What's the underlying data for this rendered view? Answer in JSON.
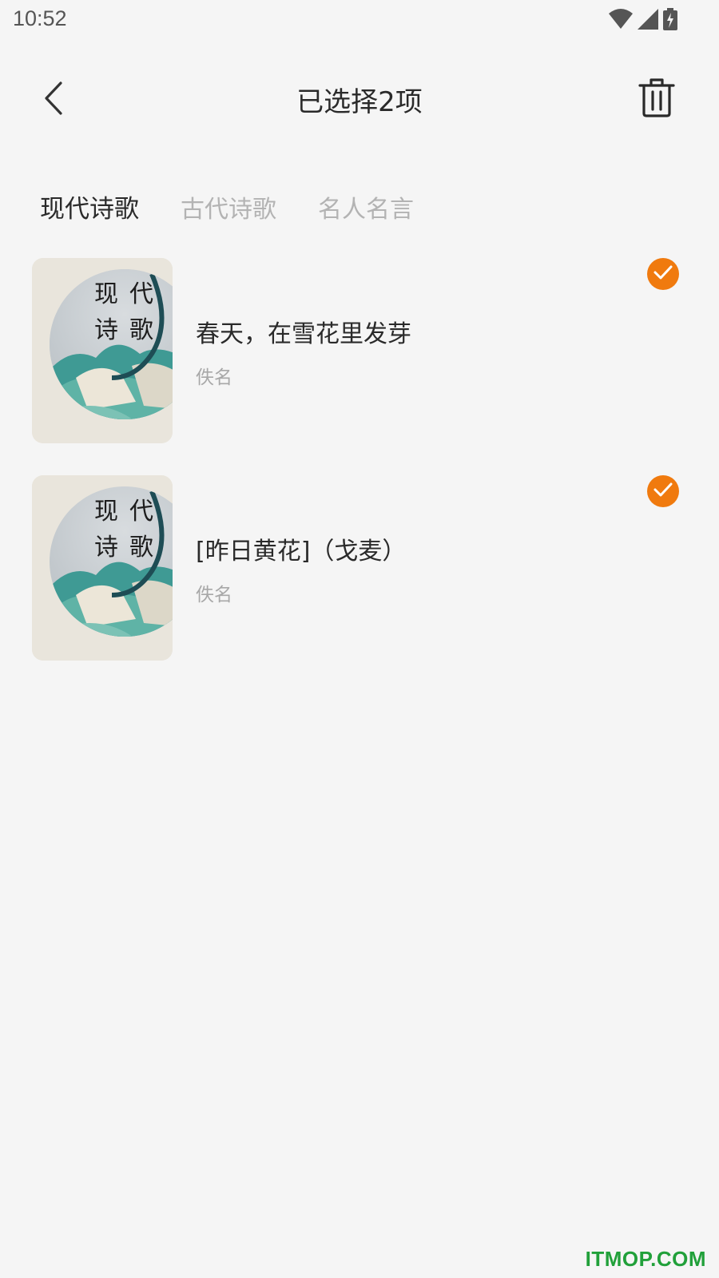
{
  "status_bar": {
    "time": "10:52",
    "icons": [
      "wifi-icon",
      "signal-icon",
      "battery-charging-icon"
    ]
  },
  "header": {
    "title": "已选择2项",
    "back_icon": "chevron-left-icon",
    "delete_icon": "trash-icon"
  },
  "tabs": [
    {
      "label": "现代诗歌",
      "active": true
    },
    {
      "label": "古代诗歌",
      "active": false
    },
    {
      "label": "名人名言",
      "active": false
    }
  ],
  "items": [
    {
      "title": "春天，在雪花里发芽",
      "author": "佚名",
      "cover_text": [
        "现",
        "代",
        "诗",
        "歌"
      ],
      "selected": true
    },
    {
      "title": "[昨日黄花]（戈麦）",
      "author": "佚名",
      "cover_text": [
        "现",
        "代",
        "诗",
        "歌"
      ],
      "selected": true
    }
  ],
  "colors": {
    "accent": "#f07a0e",
    "background": "#f5f5f5",
    "inactive_tab": "#b3b3b3",
    "watermark": "#21a03a"
  },
  "watermark": "ITMOP.COM"
}
